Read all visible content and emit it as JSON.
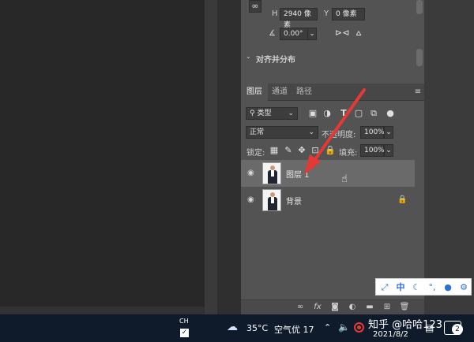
{
  "transform": {
    "h_label": "H",
    "h_value": "2940 像素",
    "y_label": "Y",
    "y_value": "0 像素",
    "angle_value": "0.00°"
  },
  "align_section": {
    "title": "对齐并分布"
  },
  "layers_panel": {
    "tabs": [
      "图层",
      "通道",
      "路径"
    ],
    "filter_kind": "类型",
    "blend_mode": "正常",
    "opacity_label": "不透明度:",
    "opacity_value": "100%",
    "lock_label": "锁定:",
    "fill_label": "填充:",
    "fill_value": "100%",
    "layers": [
      {
        "name": "图层 1",
        "selected": true
      },
      {
        "name": "背景",
        "locked": true
      }
    ]
  },
  "ime": {
    "mode": "中"
  },
  "taskbar": {
    "lang": "CH",
    "weather_temp": "35°C",
    "weather_air": "空气优 17",
    "date": "2021/8/2",
    "watermark": "知乎 @哈哈123",
    "notification_count": "2"
  },
  "colors": {
    "panel_bg": "#535353",
    "selected_layer": "#6a6a6a",
    "annotation_arrow": "#e53935",
    "taskbar_bg": "#0f1a2a"
  }
}
